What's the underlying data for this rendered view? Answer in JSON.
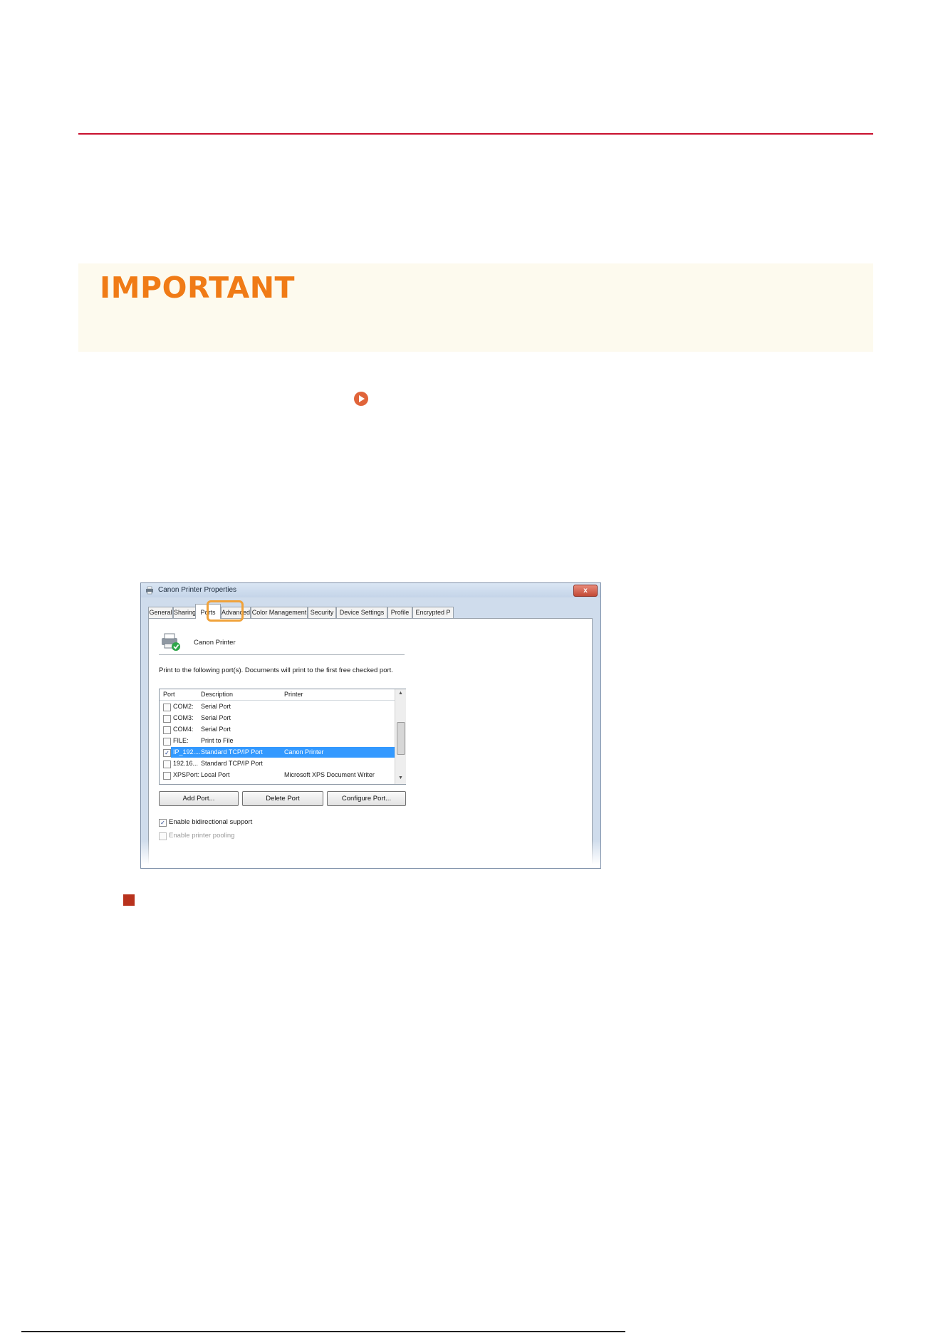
{
  "document": {
    "important_label": "IMPORTANT"
  },
  "dialog": {
    "title": "Canon Printer Properties",
    "close_label": "x",
    "tabs": [
      {
        "label": "General"
      },
      {
        "label": "Sharing"
      },
      {
        "label": "Ports"
      },
      {
        "label": "Advanced"
      },
      {
        "label": "Color Management"
      },
      {
        "label": "Security"
      },
      {
        "label": "Device Settings"
      },
      {
        "label": "Profile"
      },
      {
        "label": "Encrypted P"
      }
    ],
    "active_tab": "Ports",
    "printer_name": "Canon Printer",
    "intro_text": "Print to the following port(s). Documents will print to the first free checked port.",
    "columns": [
      "Port",
      "Description",
      "Printer"
    ],
    "ports": [
      {
        "port": "COM2:",
        "description": "Serial Port",
        "printer": "",
        "checked": false
      },
      {
        "port": "COM3:",
        "description": "Serial Port",
        "printer": "",
        "checked": false
      },
      {
        "port": "COM4:",
        "description": "Serial Port",
        "printer": "",
        "checked": false
      },
      {
        "port": "FILE:",
        "description": "Print to File",
        "printer": "",
        "checked": false
      },
      {
        "port": "IP_192....",
        "description": "Standard TCP/IP Port",
        "printer": "Canon Printer",
        "checked": true
      },
      {
        "port": "192.16...",
        "description": "Standard TCP/IP Port",
        "printer": "",
        "checked": false
      },
      {
        "port": "XPSPort:",
        "description": "Local Port",
        "printer": "Microsoft XPS Document Writer",
        "checked": false
      }
    ],
    "buttons": {
      "add_port": "Add Port...",
      "delete_port": "Delete Port",
      "configure_port": "Configure Port..."
    },
    "options": {
      "bidirectional": "Enable bidirectional support",
      "pooling": "Enable printer pooling"
    },
    "check_glyph": "✓"
  },
  "colors": {
    "rule": "#c8102e",
    "important": "#f07b16",
    "highlight": "#f0a23a",
    "selection": "#3399ff"
  }
}
